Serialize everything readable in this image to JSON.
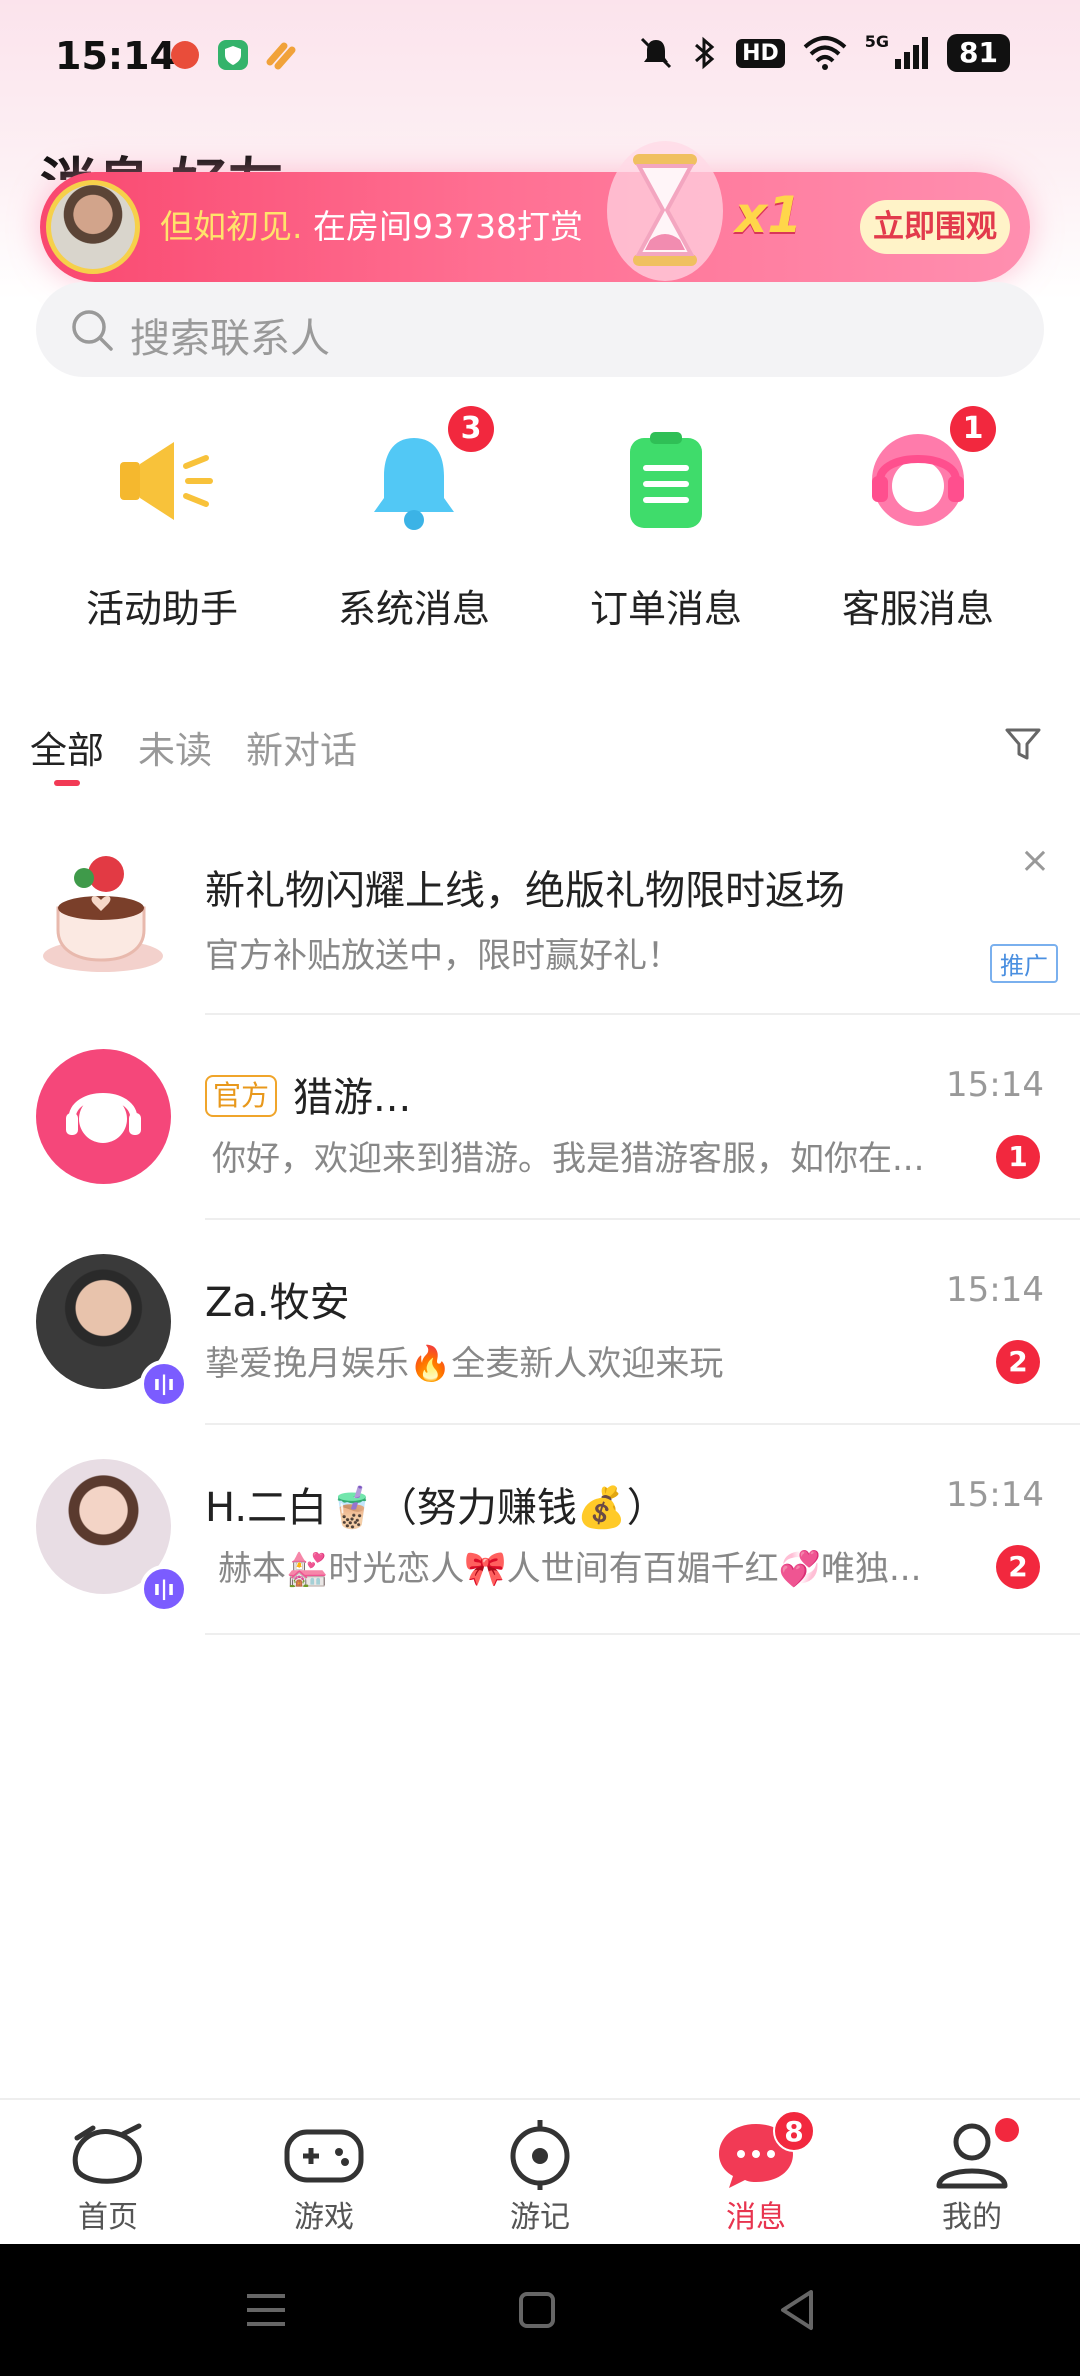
{
  "status_bar": {
    "time": "15:14",
    "net": "5G",
    "hd": "HD",
    "battery": "81"
  },
  "header": {
    "title": "消息  好友"
  },
  "banner": {
    "user": "但如初见.",
    "text": "在房间93738打赏",
    "multiplier": "x1",
    "button": "立即围观"
  },
  "search": {
    "placeholder": "搜索联系人"
  },
  "quick_actions": [
    {
      "label": "活动助手",
      "icon": "megaphone-icon",
      "color": "#f8c23a",
      "badge": ""
    },
    {
      "label": "系统消息",
      "icon": "bell-icon",
      "color": "#52c8f5",
      "badge": "3"
    },
    {
      "label": "订单消息",
      "icon": "clipboard-icon",
      "color": "#3fdc6b",
      "badge": ""
    },
    {
      "label": "客服消息",
      "icon": "headset-icon",
      "color": "#ff6fa3",
      "badge": "1"
    }
  ],
  "tabs": [
    "全部",
    "未读",
    "新对话"
  ],
  "promo": {
    "title": "新礼物闪耀上线，绝版礼物限时返场",
    "subtitle": "官方补贴放送中，限时赢好礼！",
    "tag": "推广",
    "close": "×"
  },
  "conversations": [
    {
      "official": "官方",
      "name": "猎游...",
      "time": "15:14",
      "preview": "你好，欢迎来到猎游。我是猎游客服，如你在...",
      "unread": "1"
    },
    {
      "name": "Za.牧安",
      "time": "15:14",
      "preview": "挚爱挽月娱乐🔥全麦新人欢迎来玩",
      "unread": "2"
    },
    {
      "name": "H.二白🧋（努力赚钱💰）",
      "time": "15:14",
      "preview": "赫本💒时光恋人🎀人世间有百媚千红💞唯独...",
      "unread": "2"
    }
  ],
  "bottom_nav": [
    {
      "label": "首页",
      "icon": "home-icon"
    },
    {
      "label": "游戏",
      "icon": "gamepad-icon"
    },
    {
      "label": "游记",
      "icon": "target-icon"
    },
    {
      "label": "消息",
      "icon": "chat-icon",
      "badge": "8",
      "active": true
    },
    {
      "label": "我的",
      "icon": "profile-icon"
    }
  ],
  "colors": {
    "accent": "#f23a55",
    "badge": "#f2283e",
    "active_tab": "#e8344f"
  }
}
